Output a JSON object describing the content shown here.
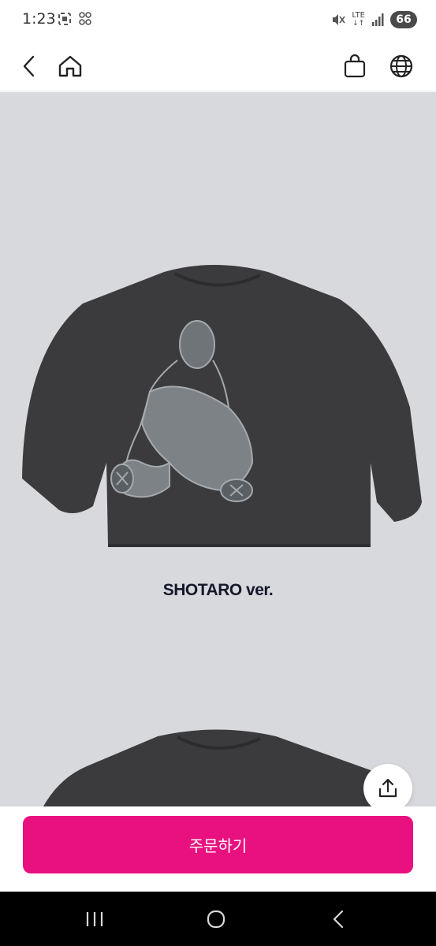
{
  "status_bar": {
    "time": "1:23",
    "network": "LTE",
    "battery": "66",
    "icons": [
      "screenshot-icon",
      "grid-app-icon",
      "mute-icon",
      "signal-icon"
    ]
  },
  "header": {
    "icons": [
      "back-arrow-icon",
      "home-icon",
      "shopping-bag-icon",
      "globe-icon"
    ]
  },
  "product": {
    "caption": "SHOTARO ver."
  },
  "floating_buttons": {
    "icons": [
      "share-icon",
      "arrow-up-icon"
    ]
  },
  "order": {
    "button_label": "주문하기",
    "button_color": "#e8117f"
  },
  "nav_bar": {
    "icons": [
      "recent-apps-icon",
      "home-circle-icon",
      "back-chevron-icon"
    ]
  },
  "colors": {
    "content_background": "#d8d9dd",
    "shirt": "#3b3b3e",
    "print": "#8d9296"
  }
}
